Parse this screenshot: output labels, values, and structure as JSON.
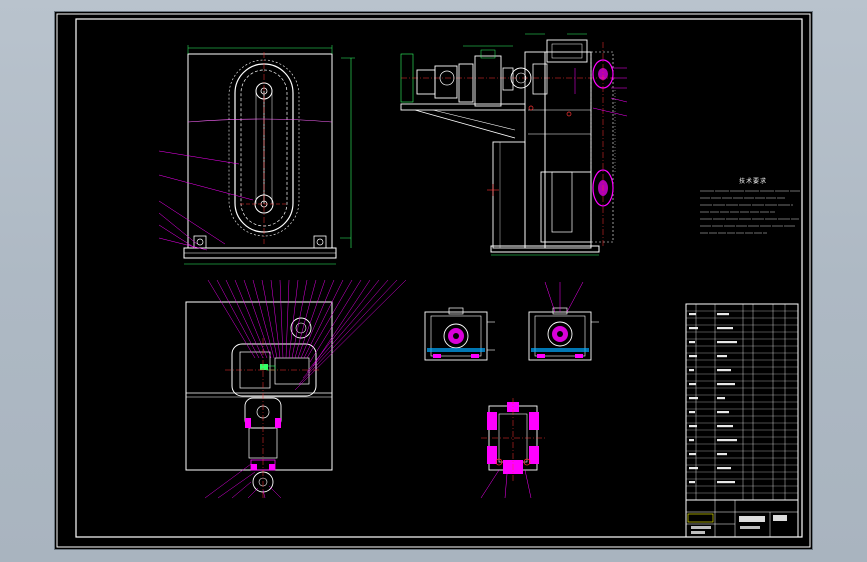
{
  "drawing": {
    "technical_requirements_title": "技术要求"
  },
  "colors": {
    "background": "#000000",
    "frame": "#ffffff",
    "leader": "#ff00ff",
    "center_line": "#ff3333",
    "dimension": "#33ff66",
    "accent": "#00ccff",
    "yellow": "#ffff00"
  }
}
